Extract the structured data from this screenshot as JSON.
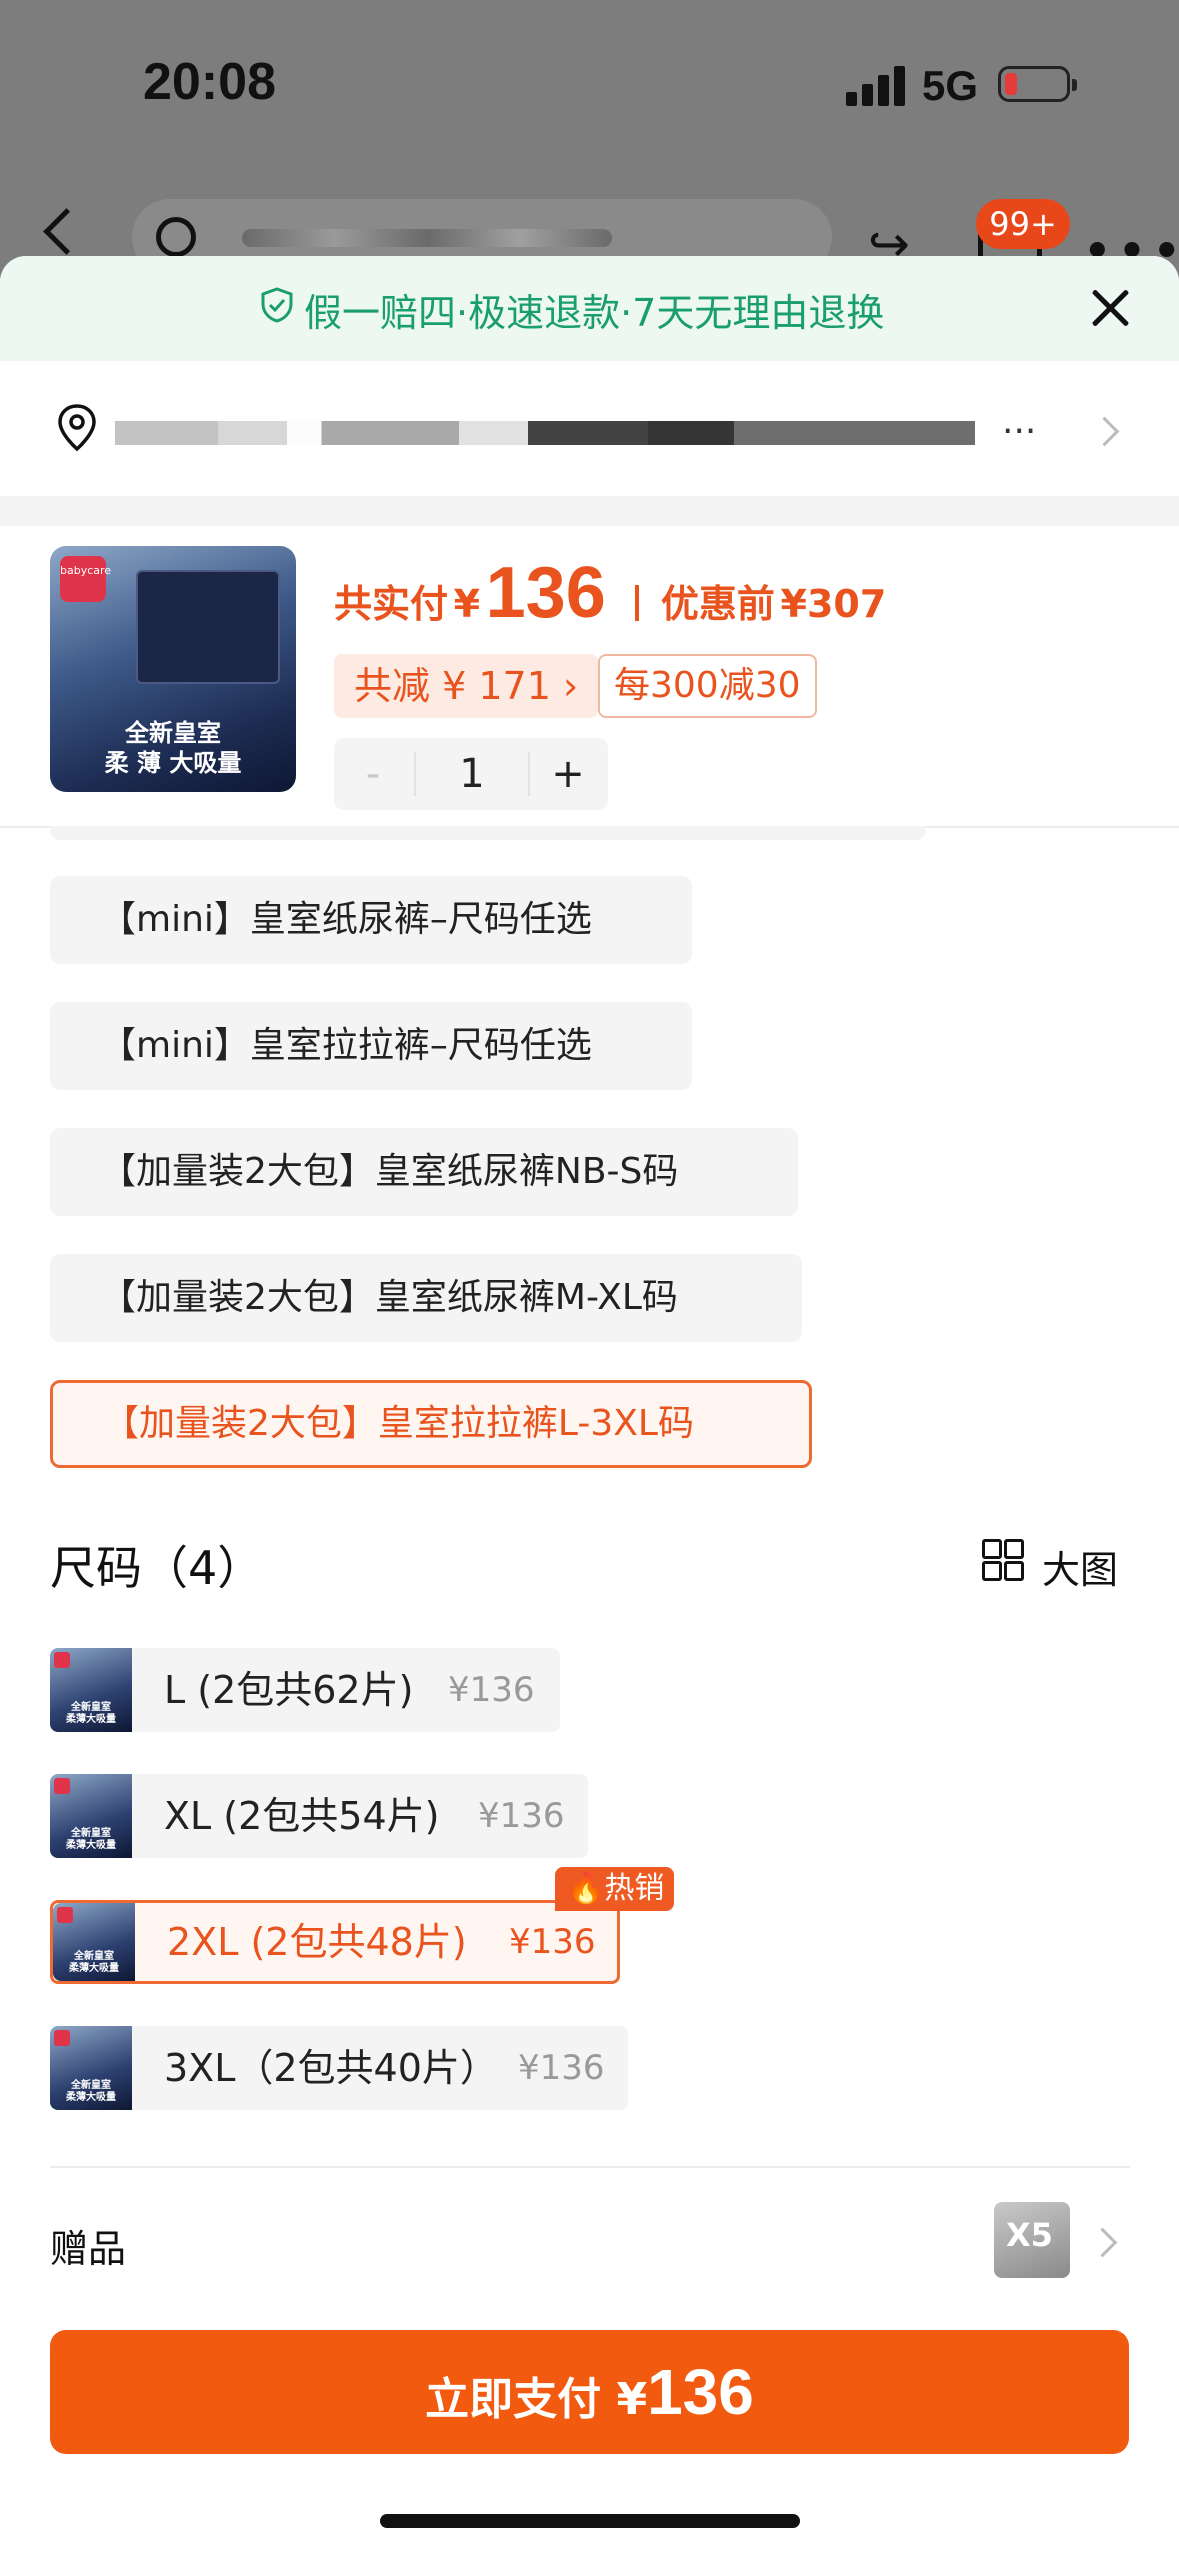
{
  "status_bar": {
    "time": "20:08",
    "network": "5G"
  },
  "background_nav": {
    "cart_badge": "99+"
  },
  "sheet": {
    "guarantee": "假一赔四·极速退款·7天无理由退换",
    "address": {
      "ellipsis": "..."
    },
    "product": {
      "paid_label": "共实付",
      "currency": "¥",
      "paid_amount": "136",
      "before_label": "优惠前",
      "before_price": "¥307",
      "discount_tag": "共减 ¥ 171 ›",
      "promo_rule": "每300减30",
      "quantity": {
        "minus": "-",
        "value": "1",
        "plus": "+"
      },
      "thumb_text": [
        "全新皇室",
        "柔 薄 大吸量"
      ]
    },
    "options": [
      {
        "label": "【mini】皇室纸尿裤–尺码任选"
      },
      {
        "label": "【mini】皇室拉拉裤–尺码任选"
      },
      {
        "label": "【加量装2大包】皇室纸尿裤NB-S码"
      },
      {
        "label": "【加量装2大包】皇室纸尿裤M-XL码"
      },
      {
        "label": "【加量装2大包】皇室拉拉裤L-3XL码",
        "selected": true
      }
    ],
    "size_section": {
      "title": "尺码（4）",
      "big_image": "大图",
      "sizes": [
        {
          "name": "L (2包共62片)",
          "price": "¥136"
        },
        {
          "name": "XL (2包共54片)",
          "price": "¥136"
        },
        {
          "name": "2XL (2包共48片)",
          "price": "¥136",
          "selected": true,
          "badge": "热销"
        },
        {
          "name": "3XL（2包共40片）",
          "price": "¥136"
        }
      ]
    },
    "gift": {
      "label": "赠品",
      "thumb": "X5"
    },
    "pay_button": {
      "label": "立即支付 ¥",
      "amount": "136"
    }
  },
  "colors": {
    "accent": "#f25a10",
    "guarantee_green": "#1a9e6e",
    "selected_border": "#ef6a33"
  }
}
